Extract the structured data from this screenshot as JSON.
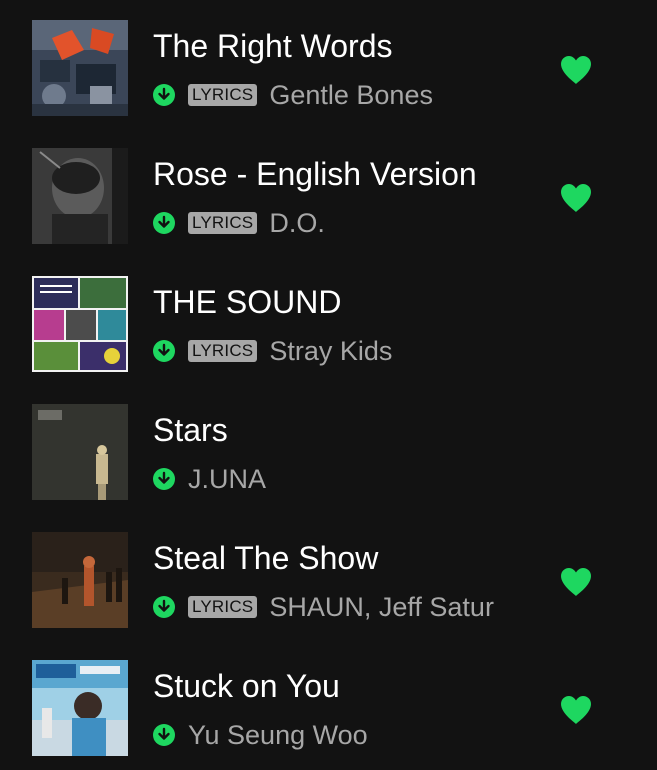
{
  "colors": {
    "background": "#121212",
    "accent": "#1ed760",
    "secondary_text": "#a7a7a7"
  },
  "tracks": [
    {
      "title": "The Right Words",
      "artist": "Gentle Bones",
      "lyrics_badge": "LYRICS",
      "has_lyrics": true,
      "downloaded": true,
      "liked": true,
      "download_icon": "download-arrow-icon",
      "like_icon": "heart-filled-icon"
    },
    {
      "title": "Rose - English Version",
      "artist": "D.O.",
      "lyrics_badge": "LYRICS",
      "has_lyrics": true,
      "downloaded": true,
      "liked": true,
      "download_icon": "download-arrow-icon",
      "like_icon": "heart-filled-icon"
    },
    {
      "title": "THE SOUND",
      "artist": "Stray Kids",
      "lyrics_badge": "LYRICS",
      "has_lyrics": true,
      "downloaded": true,
      "liked": false,
      "download_icon": "download-arrow-icon"
    },
    {
      "title": "Stars",
      "artist": "J.UNA",
      "has_lyrics": false,
      "downloaded": true,
      "liked": false,
      "download_icon": "download-arrow-icon"
    },
    {
      "title": "Steal The Show",
      "artist": "SHAUN, Jeff Satur",
      "lyrics_badge": "LYRICS",
      "has_lyrics": true,
      "downloaded": true,
      "liked": true,
      "download_icon": "download-arrow-icon",
      "like_icon": "heart-filled-icon"
    },
    {
      "title": "Stuck on You",
      "artist": "Yu Seung Woo",
      "has_lyrics": false,
      "downloaded": true,
      "liked": true,
      "download_icon": "download-arrow-icon",
      "like_icon": "heart-filled-icon"
    }
  ]
}
